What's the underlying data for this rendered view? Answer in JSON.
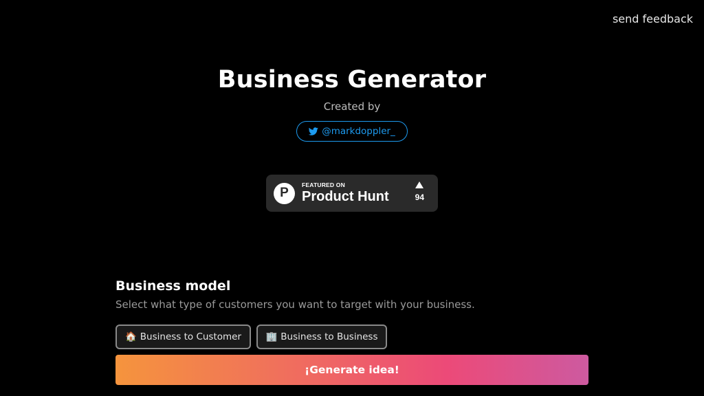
{
  "header": {
    "feedback_label": "send feedback"
  },
  "hero": {
    "title": "Business Generator",
    "created_by": "Created by",
    "twitter_handle": "@markdoppler_",
    "twitter_icon": "twitter-bird-icon",
    "twitter_color": "#1d9bf0"
  },
  "product_hunt": {
    "logo_letter": "P",
    "featured_on": "FEATURED ON",
    "name": "Product Hunt",
    "votes": "94"
  },
  "business_model": {
    "title": "Business model",
    "description": "Select what type of customers you want to target with your business.",
    "options": [
      {
        "emoji": "🏠",
        "label": "Business to Customer"
      },
      {
        "emoji": "🏢",
        "label": "Business to Business"
      }
    ]
  },
  "generate_label": "¡Generate idea!",
  "colors": {
    "background": "#000000",
    "gradient_start": "#f5943d",
    "gradient_end": "#cd5aa0"
  }
}
